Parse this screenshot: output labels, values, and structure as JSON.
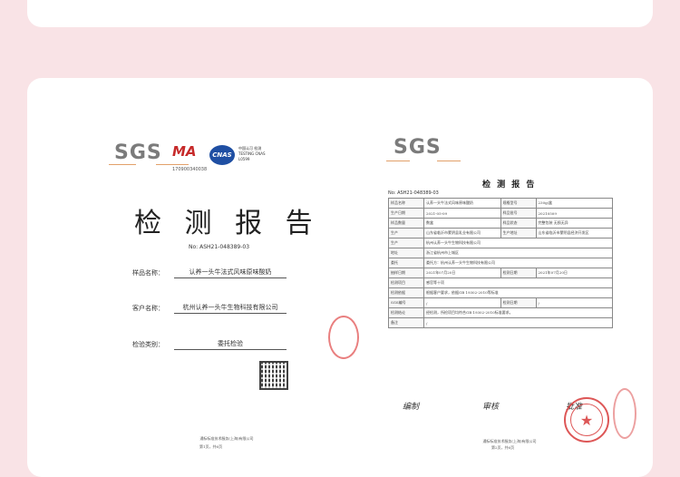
{
  "cover": {
    "sgs": "SGS",
    "ma_mark": "MA",
    "ma_number": "170900340038",
    "cnas_mark": "CNAS",
    "cnas_text": "中国认可 检测 TESTING CNAS L0599",
    "title": "检 测 报 告",
    "report_no": "No: ASH21-048389-03",
    "fields": [
      {
        "label": "样品名称：",
        "value": "认养一头牛法式风味原味酸奶"
      },
      {
        "label": "客户名称：",
        "value": "杭州认养一头牛生物科技有限公司"
      },
      {
        "label": "检验类别：",
        "value": "委托检验"
      }
    ],
    "footer": "通标标准技术服务(上海)有限公司",
    "page": "第1页，共6页"
  },
  "report": {
    "sgs": "SGS",
    "title": "检 测 报 告",
    "report_no": "No: ASH21-048389-03",
    "rows": [
      [
        "样品名称",
        "认养一头牛法式风味原味酸奶",
        "规格型号",
        "230g/盒"
      ],
      [
        "生产日期",
        "2021-05-09",
        "样品批号",
        "20210509"
      ],
      [
        "样品数量",
        "数盒",
        "样品状态",
        "完整包装 无损无异"
      ],
      [
        "生产",
        "山东省临沂市蒙阴县乳业有限公司",
        "生产地址",
        "山东省临沂市蒙阴县经济开发区"
      ],
      [
        "生产",
        "杭州认养一头牛生物科技有限公司",
        "",
        ""
      ],
      [
        "地址",
        "浙江省杭州市上城区",
        "",
        ""
      ],
      [
        "委托",
        "委托方：杭州认养一头牛生物科技有限公司",
        "",
        ""
      ],
      [
        "抽样日期",
        "2021年07月20日",
        "检测日期",
        "2021年07月20日"
      ],
      [
        "检测项目",
        "感官等十项",
        "",
        ""
      ],
      [
        "检测依据",
        "根据客户要求，依据GB 19302-2010等标准",
        "",
        ""
      ],
      [
        "SGS编号",
        "/",
        "检测日期",
        "/"
      ],
      [
        "检测结论",
        "经检测，所检项目均符合GB 19302-2010标准要求。",
        "",
        ""
      ],
      [
        "备注",
        "/",
        "",
        ""
      ]
    ],
    "signatures": [
      "编制",
      "审核",
      "批准"
    ],
    "footer": "通标标准技术服务(上海)有限公司",
    "page": "第2页，共6页"
  }
}
